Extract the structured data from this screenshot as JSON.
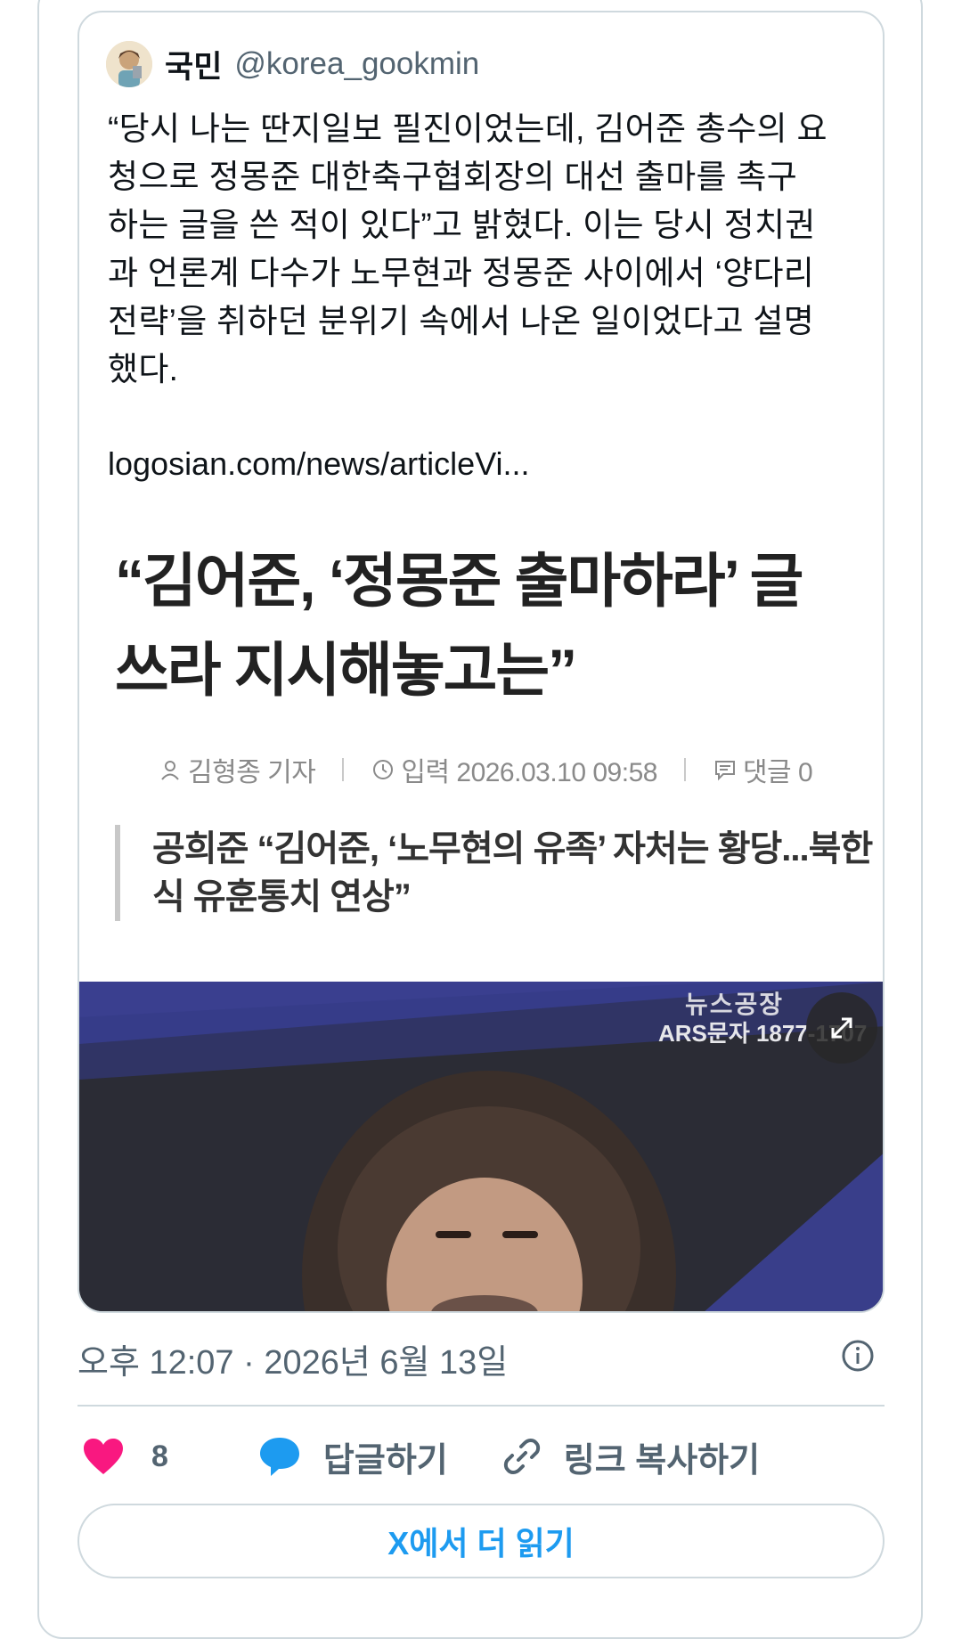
{
  "quoted_tweet": {
    "author_name": "국민",
    "author_handle": "@korea_gookmin",
    "text": "“당시 나는 딴지일보 필진이었는데, 김어준 총수의 요\n청으로 정몽준 대한축구협회장의 대선 출마를 촉구\n하는 글을 쓴 적이 있다”고 밝혔다. 이는 당시 정치권\n과 언론계 다수가 노무현과 정몽준 사이에서 ‘양다리\n전략’을 취하던 분위기 속에서 나온 일이었다고 설명\n했다.",
    "link": "logosian.com/news/articleVi...",
    "article": {
      "headline": "“김어준, ‘정몽준 출마하라’ 글 쓰라 지시해놓고는”",
      "reporter": "김형종 기자",
      "input_date": "입력 2026.03.10 09:58",
      "comments": "댓글 0",
      "subheadline": "공희준 “김어준, ‘노무현의 유족’ 자처는 황당...북한식 유훈통치 연상”",
      "photo_overlay_text": "ARS문자 1877-1707",
      "photo_banner": "뉴스공장"
    }
  },
  "timestamp": "오후 12:07 · 2026년 6월 13일",
  "actions": {
    "like_count": "8",
    "reply_label": "답글하기",
    "copy_link_label": "링크 복사하기"
  },
  "read_more_label": "X에서 더 읽기",
  "colors": {
    "accent": "#1d9bf0",
    "like": "#f91880",
    "secondary_text": "#536471",
    "border": "#cfd9de"
  },
  "icons": [
    "avatar",
    "person-icon",
    "clock-icon",
    "comment-icon",
    "expand-icon",
    "info-icon",
    "heart-icon",
    "reply-bubble-icon",
    "link-icon"
  ]
}
